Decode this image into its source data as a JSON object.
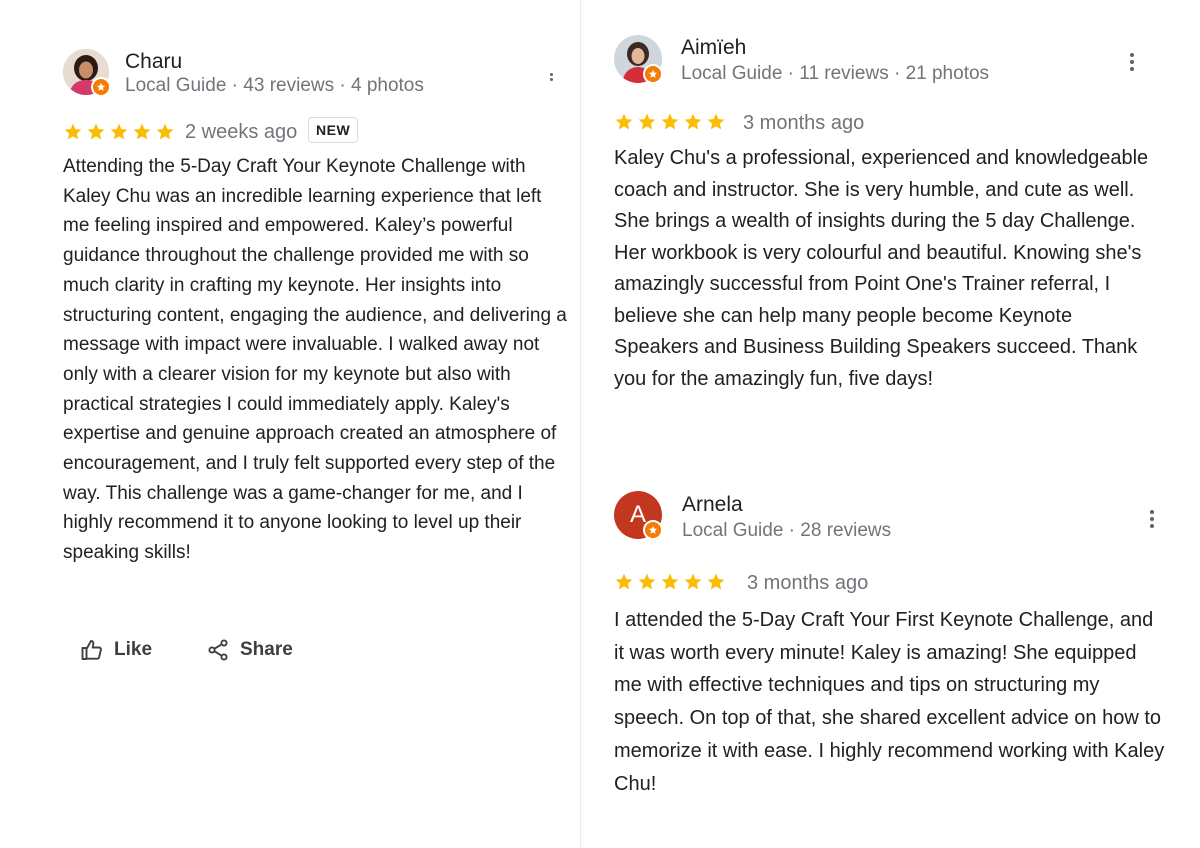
{
  "reviews": [
    {
      "name": "Charu",
      "meta": "Local Guide · 43 reviews · 4 photos",
      "rating": 5,
      "time": "2 weeks ago",
      "new_label": "NEW",
      "text": "Attending the 5-Day Craft Your Keynote Challenge with Kaley Chu was an incredible learning experience that left me feeling inspired and empowered. Kaley’s powerful guidance throughout the challenge provided me with so much clarity in crafting my keynote. Her insights into structuring content, engaging the audience, and delivering a message with impact were invaluable. I walked away not only with a clearer vision for my keynote but also with practical strategies I could immediately apply. Kaley's expertise and genuine approach created an atmosphere of encouragement, and I truly felt supported every step of the way. This challenge was a game-changer for me, and I highly recommend it to anyone looking to level up their speaking skills!",
      "like_label": "Like",
      "share_label": "Share"
    },
    {
      "name": "Aimïeh",
      "meta": "Local Guide · 11 reviews · 21 photos",
      "rating": 5,
      "time": "3 months ago",
      "text": "Kaley Chu's a professional, experienced and knowledgeable coach and instructor. She is very humble, and cute as well. She brings a wealth of insights during the 5 day Challenge. Her workbook is very colourful and beautiful. Knowing she's amazingly successful from Point One's Trainer referral, I believe she can help many people become Keynote Speakers and Business Building Speakers succeed. Thank you for the amazingly fun, five days!"
    },
    {
      "name": "Arnela",
      "avatar_letter": "A",
      "meta": "Local Guide · 28 reviews",
      "rating": 5,
      "time": "3 months ago",
      "text": "I attended the 5-Day Craft Your First Keynote Challenge, and it was worth every minute! Kaley is amazing! She equipped me with effective techniques and tips on structuring my speech. On top of that, she shared excellent advice on how to memorize it with ease. I highly recommend working with Kaley Chu!"
    }
  ],
  "colors": {
    "star": "#fbbc04",
    "avatar_arnela": "#c1381e",
    "local_guide_badge": "#f57c00"
  }
}
